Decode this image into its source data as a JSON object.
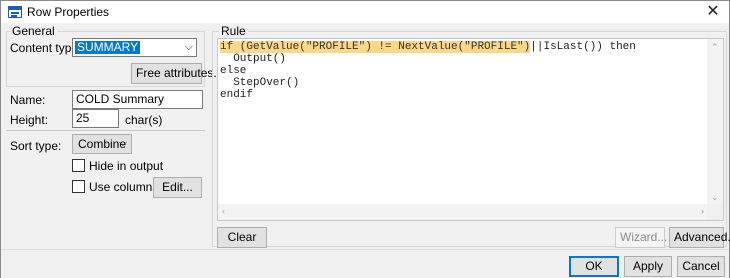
{
  "window": {
    "title": "Row Properties"
  },
  "general": {
    "group_title": "General",
    "content_type_label": "Content type:",
    "content_type_value": "SUMMARY",
    "free_attributes_button": "Free attributes..."
  },
  "fields": {
    "name_label": "Name:",
    "name_value": "COLD Summary",
    "height_label": "Height:",
    "height_value": "25",
    "height_unit": "char(s)"
  },
  "sort": {
    "sort_type_label": "Sort type:",
    "sort_type_value": "Combine",
    "hide_in_output_label": "Hide in output",
    "use_columns_label": "Use columns",
    "edit_button": "Edit..."
  },
  "rule": {
    "group_title": "Rule",
    "line1_highlight": "if (GetValue(\"PROFILE\") != NextValue(\"PROFILE\")",
    "line1_rest": "||IsLast()) then",
    "lines": [
      "  Output()",
      "else",
      "  StepOver()",
      "endif"
    ],
    "clear_button": "Clear",
    "wizard_button": "Wizard...",
    "advanced_button": "Advanced..."
  },
  "footer": {
    "ok_button": "OK",
    "apply_button": "Apply",
    "cancel_button": "Cancel"
  },
  "colors": {
    "accent": "#0078d7",
    "highlight": "#fbd789"
  }
}
